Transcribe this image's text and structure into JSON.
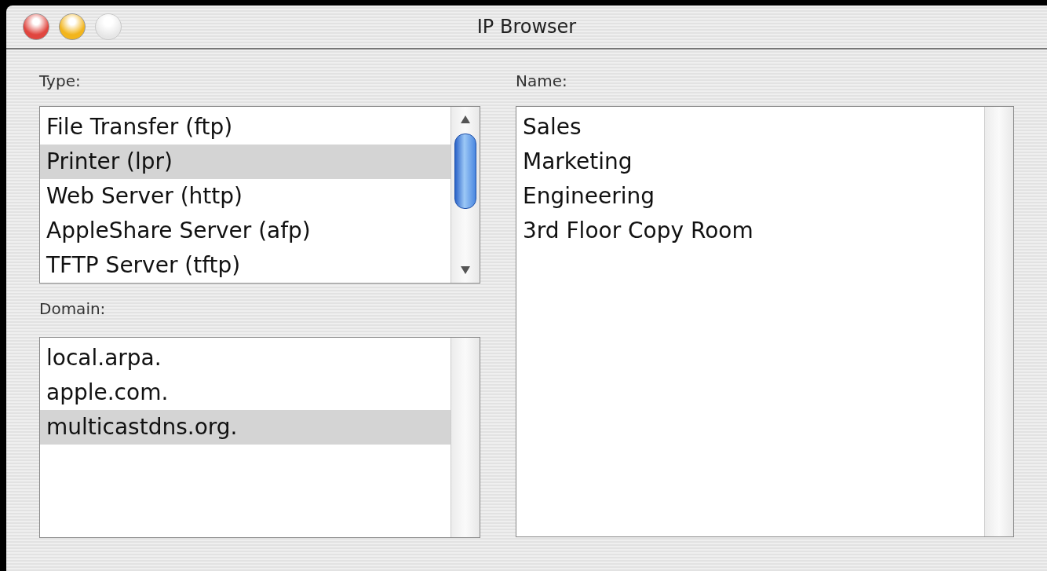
{
  "window": {
    "title": "IP Browser",
    "controls": [
      {
        "kind": "close",
        "disabled": false
      },
      {
        "kind": "minimize",
        "disabled": false
      },
      {
        "kind": "zoom",
        "disabled": true
      }
    ]
  },
  "type_panel": {
    "label": "Type:",
    "items": [
      {
        "text": "File Transfer (ftp)",
        "selected": false
      },
      {
        "text": "Printer (lpr)",
        "selected": true
      },
      {
        "text": "Web Server (http)",
        "selected": false
      },
      {
        "text": "AppleShare Server (afp)",
        "selected": false
      },
      {
        "text": "TFTP Server (tftp)",
        "selected": false
      }
    ]
  },
  "domain_panel": {
    "label": "Domain:",
    "items": [
      {
        "text": "local.arpa.",
        "selected": false
      },
      {
        "text": "apple.com.",
        "selected": false
      },
      {
        "text": "multicastdns.org.",
        "selected": true
      }
    ]
  },
  "name_panel": {
    "label": "Name:",
    "items": [
      {
        "text": "Sales",
        "selected": false
      },
      {
        "text": "Marketing",
        "selected": false
      },
      {
        "text": "Engineering",
        "selected": false
      },
      {
        "text": "3rd Floor Copy Room",
        "selected": false
      }
    ]
  }
}
